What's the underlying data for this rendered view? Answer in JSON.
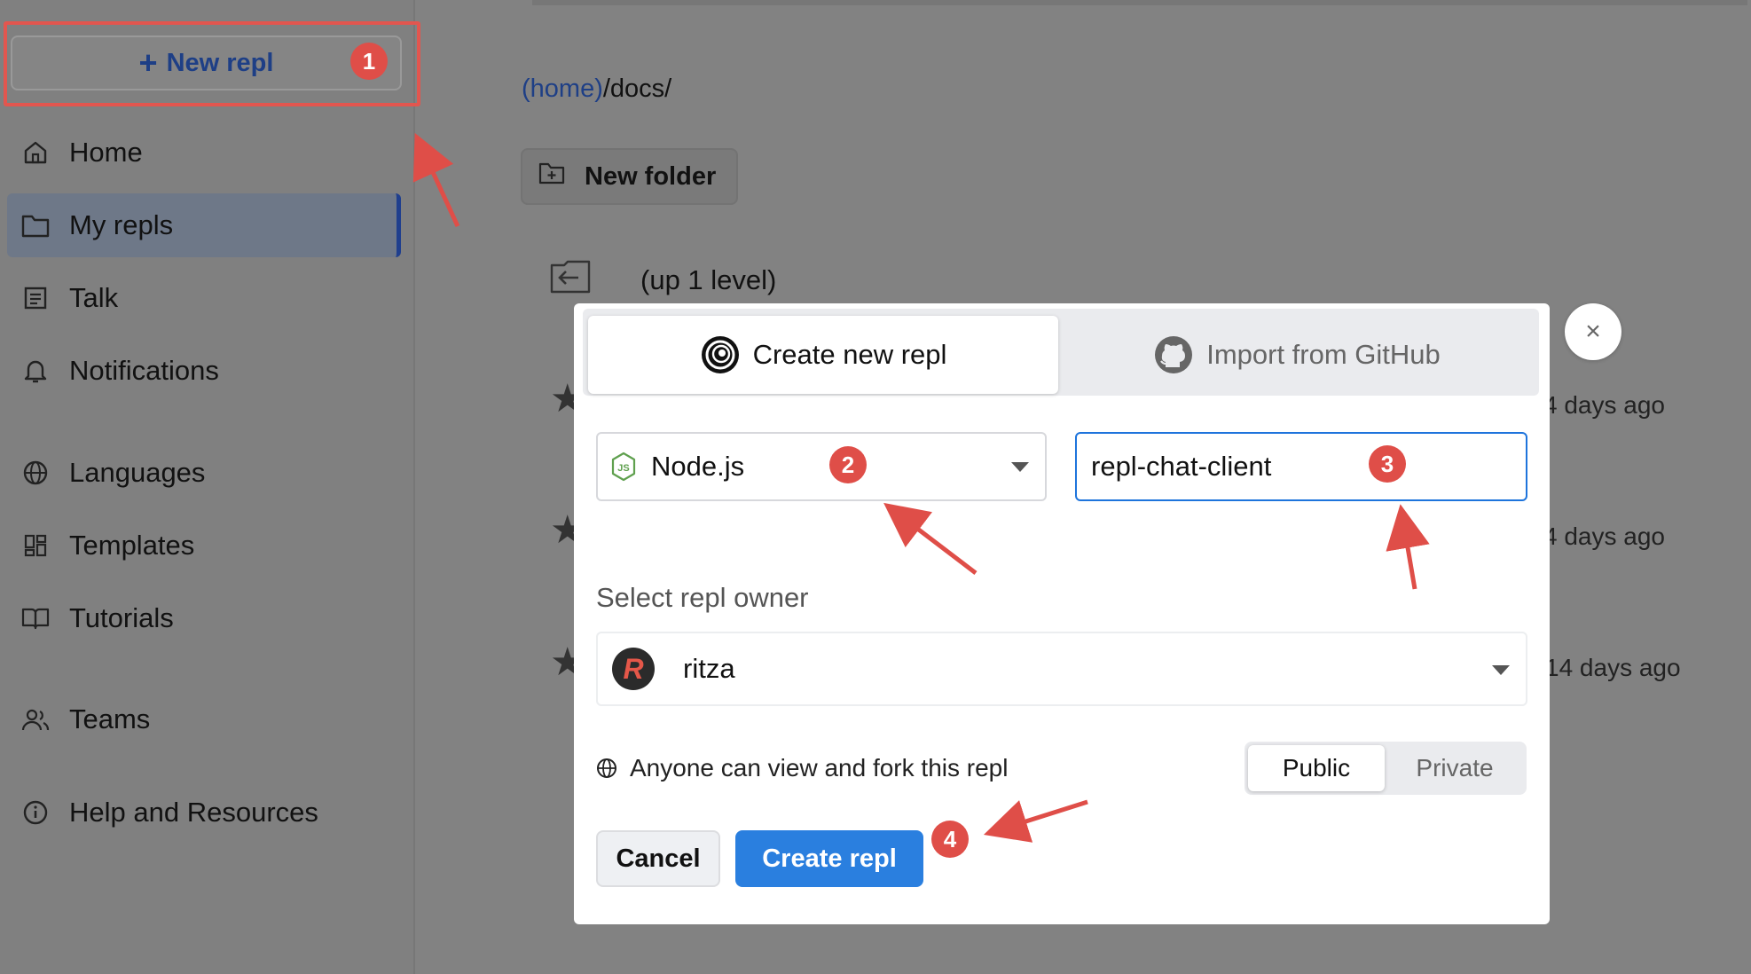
{
  "sidebar": {
    "new_repl_label": "New repl",
    "items": [
      {
        "label": "Home",
        "icon": "home-icon"
      },
      {
        "label": "My repls",
        "icon": "folder-icon",
        "active": true
      },
      {
        "label": "Talk",
        "icon": "talk-icon"
      },
      {
        "label": "Notifications",
        "icon": "bell-icon"
      },
      {
        "label": "Languages",
        "icon": "globe-icon"
      },
      {
        "label": "Templates",
        "icon": "templates-icon"
      },
      {
        "label": "Tutorials",
        "icon": "book-icon"
      },
      {
        "label": "Teams",
        "icon": "people-icon"
      },
      {
        "label": "Help and Resources",
        "icon": "info-icon"
      }
    ]
  },
  "main": {
    "breadcrumb": {
      "home": "(home)",
      "path": "/docs/"
    },
    "new_folder_label": "New folder",
    "up_level_label": "(up 1 level)",
    "rows": [
      {
        "time": "4 days ago"
      },
      {
        "time": "4 days ago"
      },
      {
        "time": "14 days ago"
      }
    ]
  },
  "modal": {
    "tabs": [
      {
        "label": "Create new repl",
        "icon": "replit-icon",
        "active": true
      },
      {
        "label": "Import from GitHub",
        "icon": "github-icon",
        "active": false
      }
    ],
    "language": {
      "value": "Node.js",
      "icon": "nodejs-icon"
    },
    "repl_name": {
      "value": "repl-chat-client"
    },
    "owner": {
      "label": "Select repl owner",
      "value": "ritza",
      "avatar_letter": "R"
    },
    "visibility": {
      "description": "Anyone can view and fork this repl",
      "options": [
        "Public",
        "Private"
      ],
      "selected": "Public"
    },
    "cancel_label": "Cancel",
    "create_label": "Create repl",
    "close_symbol": "×"
  },
  "annotations": {
    "badges": [
      "1",
      "2",
      "3",
      "4"
    ],
    "color": "#df4e48"
  },
  "colors": {
    "accent": "#2a7fdf",
    "focus_border": "#1e74dc",
    "active_nav_border": "#1f3f8e",
    "overlay": "#828282"
  }
}
